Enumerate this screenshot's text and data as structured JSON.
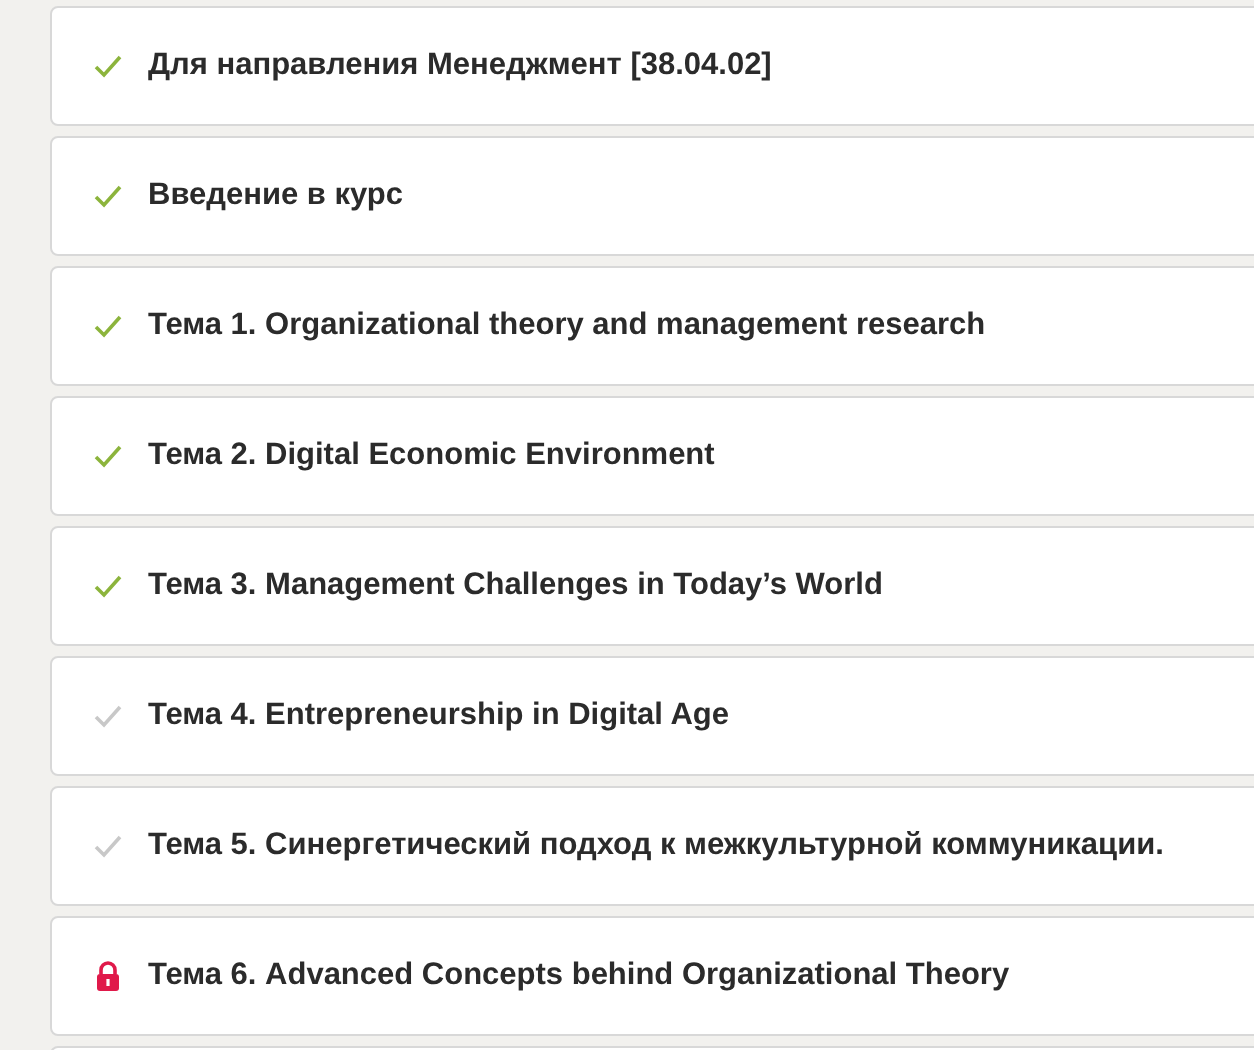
{
  "sections": [
    {
      "title": "Для направления Менеджмент [38.04.02]",
      "locked": false,
      "completed": true
    },
    {
      "title": "Введение в курс",
      "locked": false,
      "completed": true
    },
    {
      "title": "Тема 1. Organizational theory and management research",
      "locked": false,
      "completed": true
    },
    {
      "title": "Тема 2. Digital Economic Environment",
      "locked": false,
      "completed": true
    },
    {
      "title": "Тема 3. Management Challenges in Today’s World",
      "locked": false,
      "completed": true
    },
    {
      "title": "Тема 4. Entrepreneurship in Digital Age",
      "locked": false,
      "completed": false
    },
    {
      "title": "Тема 5. Синергетический подход к межкультурной коммуникации.",
      "locked": false,
      "completed": false
    },
    {
      "title": "Тема 6. Advanced Concepts behind Organizational Theory",
      "locked": true
    }
  ]
}
